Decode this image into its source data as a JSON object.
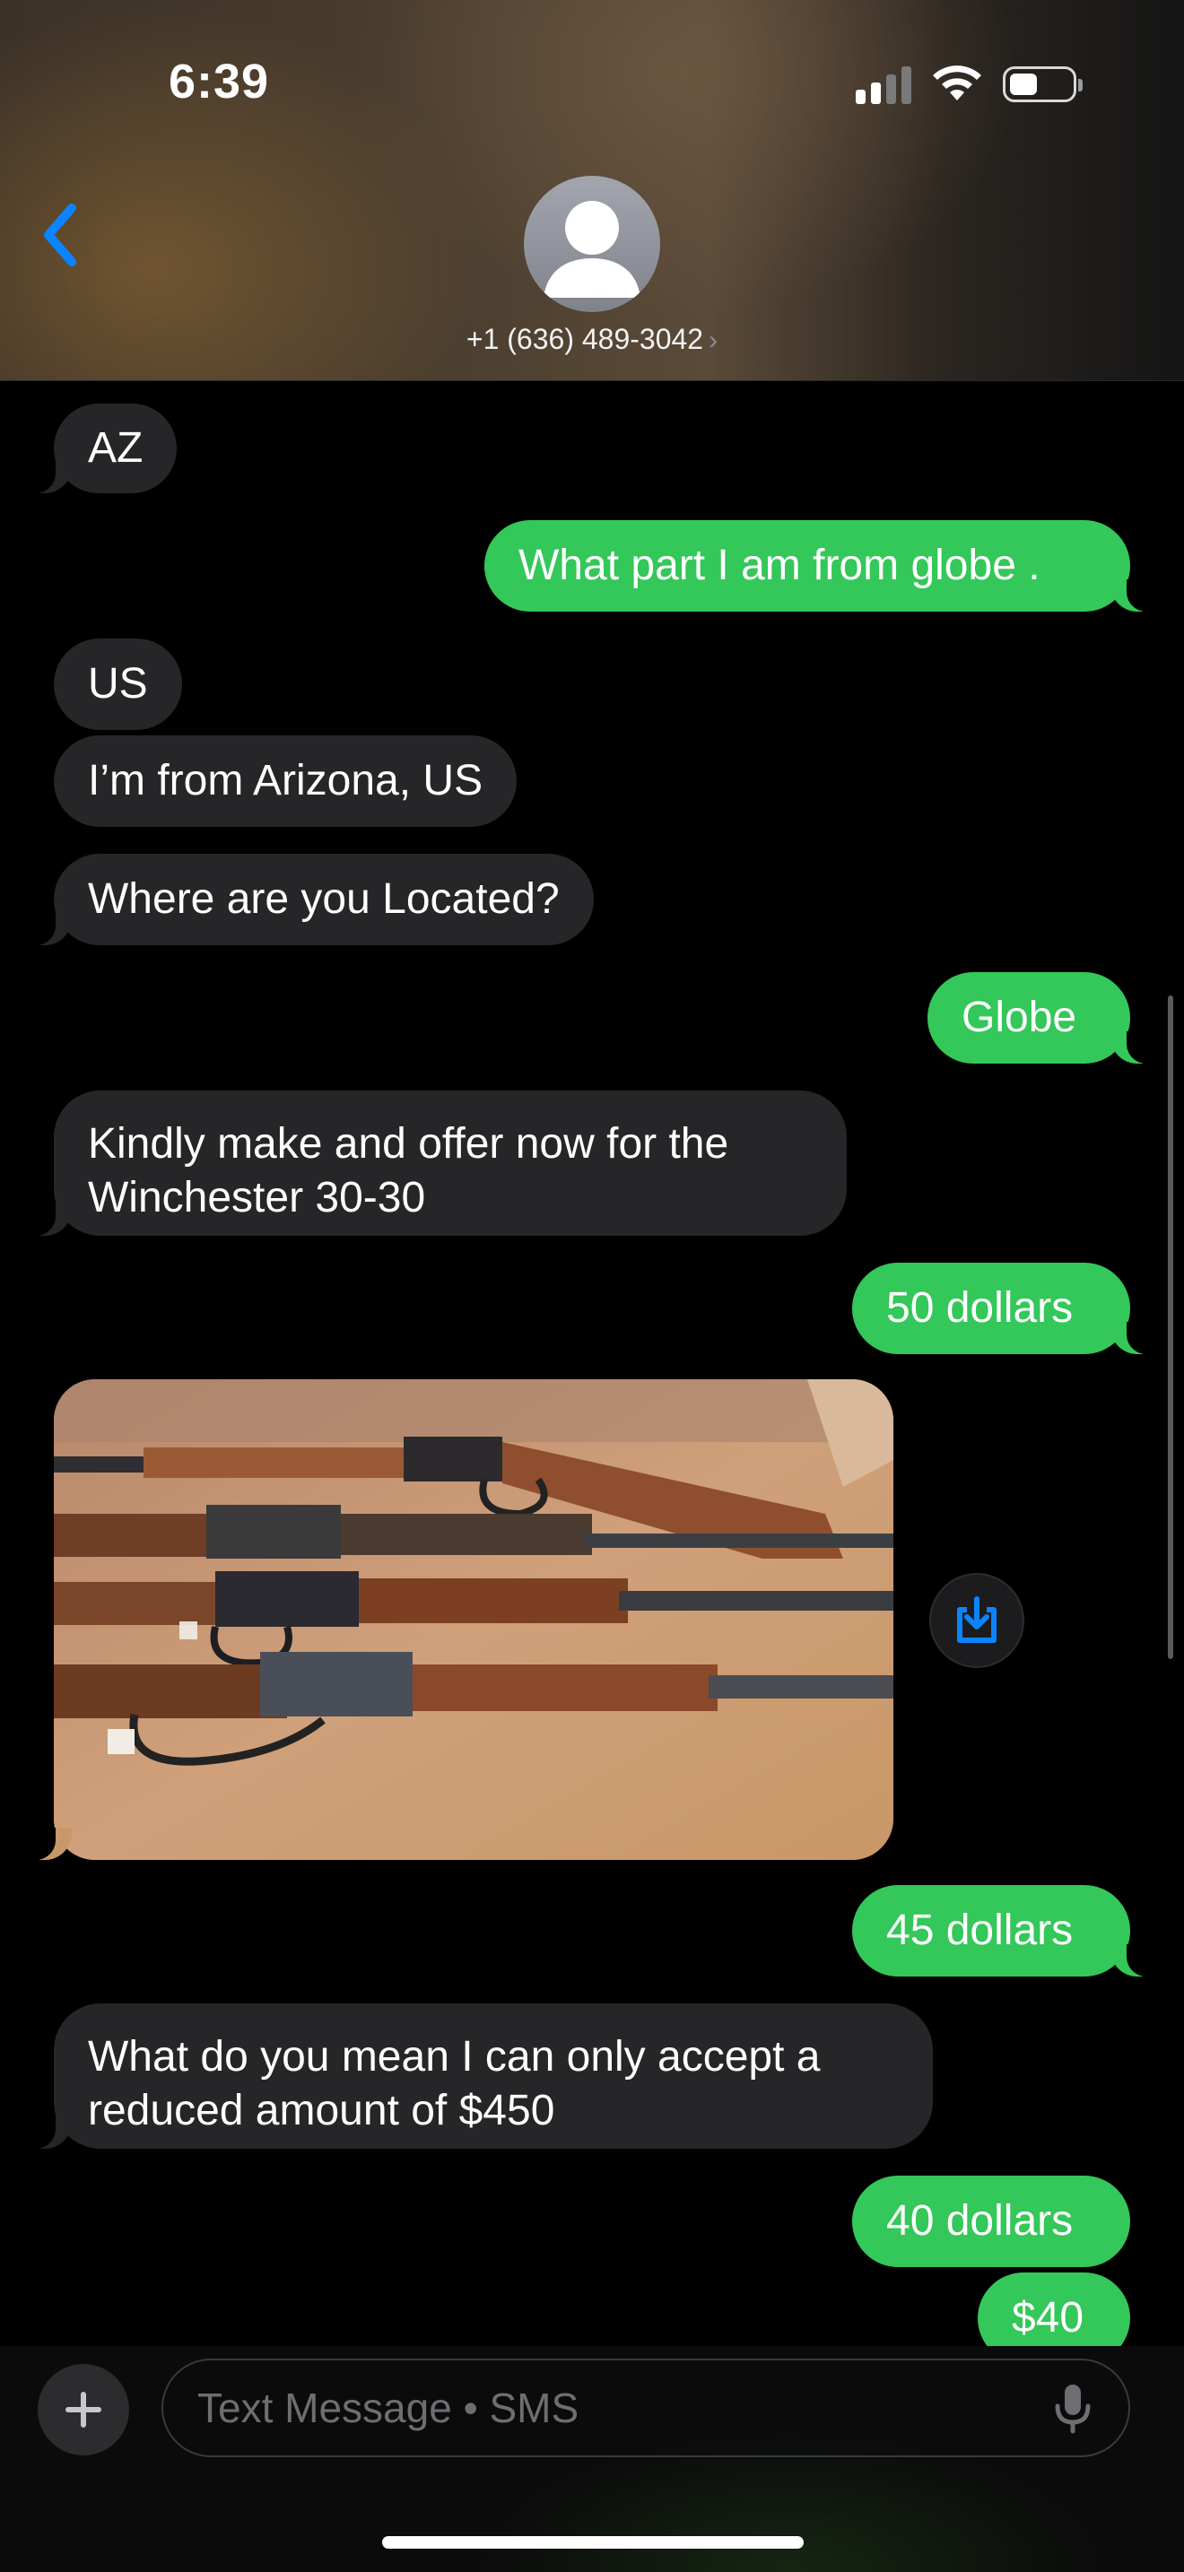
{
  "status_bar": {
    "time": "6:39",
    "icons": [
      "cellular-signal-icon",
      "wifi-icon",
      "battery-icon"
    ]
  },
  "header": {
    "back_icon": "chevron-left-icon",
    "avatar_icon": "person-silhouette-icon",
    "contact": "+1 (636) 489-3042",
    "contact_chevron": "›"
  },
  "messages": [
    {
      "direction": "received",
      "text": "AZ"
    },
    {
      "direction": "sent",
      "text": "What part I am from globe ."
    },
    {
      "direction": "received",
      "text": "US"
    },
    {
      "direction": "received",
      "text": "I’m from Arizona, US"
    },
    {
      "direction": "received",
      "text": "Where are you Located?"
    },
    {
      "direction": "sent",
      "text": "Globe"
    },
    {
      "direction": "received",
      "text": "Kindly make and offer now for the Winchester 30-30"
    },
    {
      "direction": "sent",
      "text": "50 dollars"
    },
    {
      "direction": "received",
      "type": "photo",
      "subject": "lever-action-rifles-photo"
    },
    {
      "direction": "sent",
      "text": "45 dollars"
    },
    {
      "direction": "received",
      "text": "What do you mean I can only accept a reduced amount of $450"
    },
    {
      "direction": "sent",
      "text": "40 dollars"
    },
    {
      "direction": "sent",
      "text": "$40"
    }
  ],
  "compose": {
    "placeholder": "Text Message • SMS",
    "plus_icon": "plus-icon",
    "mic_icon": "microphone-icon",
    "save_icon": "save-to-photos-icon"
  },
  "colors": {
    "sent_bubble": "#34c759",
    "received_bubble": "#262628",
    "accent": "#0a84ff",
    "background": "#000000"
  }
}
